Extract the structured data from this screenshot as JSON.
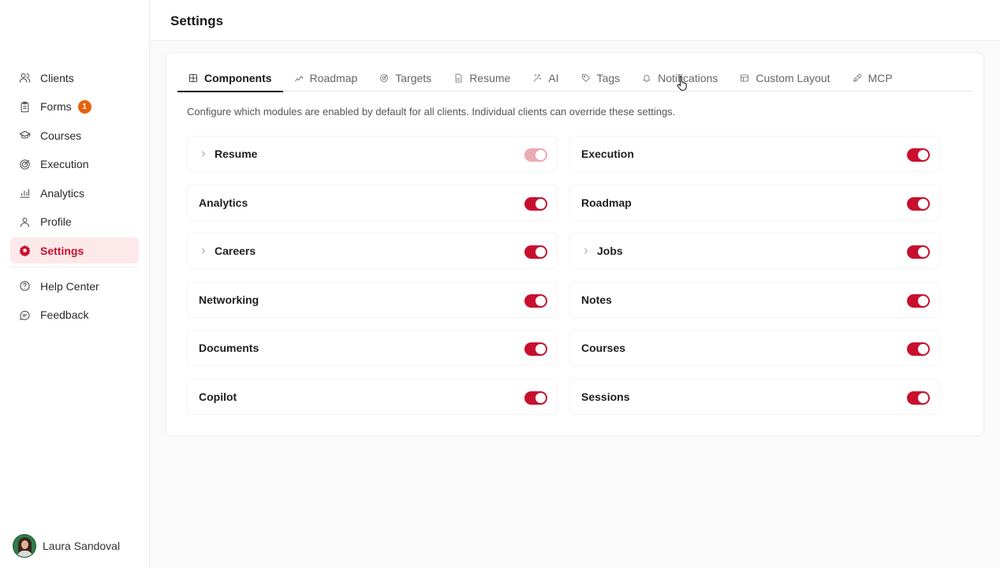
{
  "sidebar": {
    "items": [
      {
        "label": "Clients",
        "icon": "users-icon"
      },
      {
        "label": "Forms",
        "icon": "clipboard-icon",
        "badge": "1"
      },
      {
        "label": "Courses",
        "icon": "graduation-cap-icon"
      },
      {
        "label": "Execution",
        "icon": "target-icon"
      },
      {
        "label": "Analytics",
        "icon": "bar-chart-icon"
      },
      {
        "label": "Profile",
        "icon": "user-icon"
      },
      {
        "label": "Settings",
        "icon": "gear-icon",
        "active": true
      }
    ],
    "secondary": [
      {
        "label": "Help Center",
        "icon": "help-circle-icon"
      },
      {
        "label": "Feedback",
        "icon": "message-circle-icon"
      }
    ],
    "user": {
      "name": "Laura Sandoval"
    }
  },
  "header": {
    "title": "Settings"
  },
  "tabs": [
    {
      "label": "Components",
      "icon": "grid-icon",
      "active": true
    },
    {
      "label": "Roadmap",
      "icon": "route-icon"
    },
    {
      "label": "Targets",
      "icon": "target-icon"
    },
    {
      "label": "Resume",
      "icon": "file-icon"
    },
    {
      "label": "AI",
      "icon": "sparkles-icon"
    },
    {
      "label": "Tags",
      "icon": "tag-icon"
    },
    {
      "label": "Notifications",
      "icon": "bell-icon"
    },
    {
      "label": "Custom Layout",
      "icon": "layout-icon"
    },
    {
      "label": "MCP",
      "icon": "plug-icon"
    }
  ],
  "description": "Configure which modules are enabled by default for all clients. Individual clients can override these settings.",
  "modules": {
    "left": [
      {
        "label": "Resume",
        "expandable": true,
        "enabled": true,
        "dim": true
      },
      {
        "label": "Analytics",
        "expandable": false,
        "enabled": true
      },
      {
        "label": "Careers",
        "expandable": true,
        "enabled": true
      },
      {
        "label": "Networking",
        "expandable": false,
        "enabled": true
      },
      {
        "label": "Documents",
        "expandable": false,
        "enabled": true
      },
      {
        "label": "Copilot",
        "expandable": false,
        "enabled": true
      }
    ],
    "right": [
      {
        "label": "Execution",
        "expandable": false,
        "enabled": true
      },
      {
        "label": "Roadmap",
        "expandable": false,
        "enabled": true
      },
      {
        "label": "Jobs",
        "expandable": true,
        "enabled": true
      },
      {
        "label": "Notes",
        "expandable": false,
        "enabled": true
      },
      {
        "label": "Courses",
        "expandable": false,
        "enabled": true
      },
      {
        "label": "Sessions",
        "expandable": false,
        "enabled": true
      }
    ]
  },
  "colors": {
    "accent": "#c8102e",
    "badge": "#e8620c",
    "active_bg": "#fde8ea"
  }
}
